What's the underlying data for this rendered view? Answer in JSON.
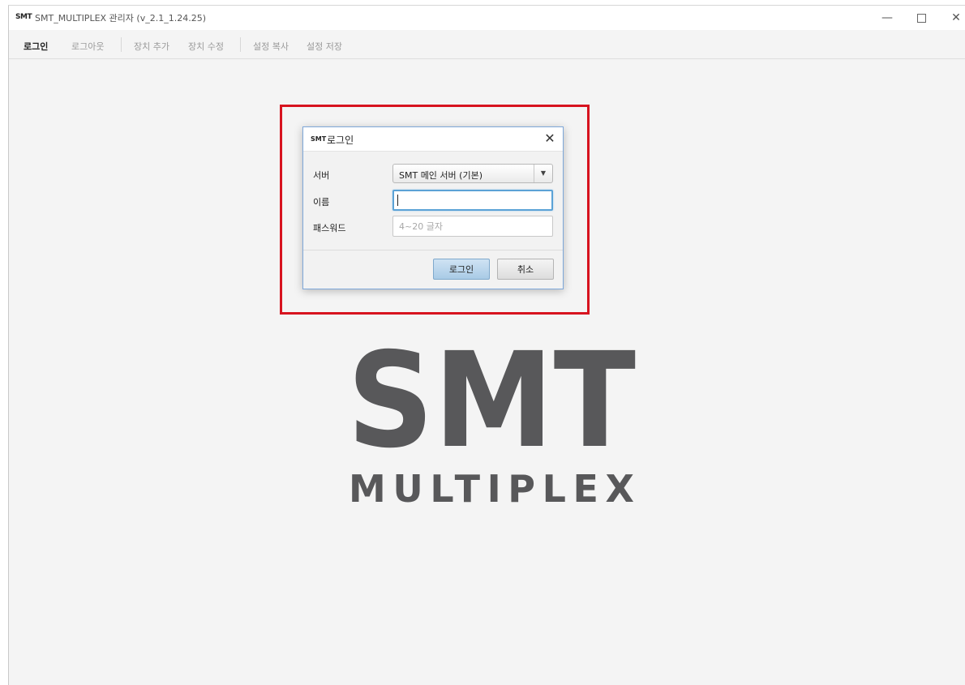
{
  "window": {
    "logo": "SMT",
    "title": "SMT_MULTIPLEX 관리자 (v_2.1_1.24.25)",
    "minimize": "—",
    "close": "✕"
  },
  "menu": {
    "items": [
      {
        "label": "로그인",
        "active": true
      },
      {
        "label": "로그아웃",
        "active": false
      },
      {
        "label": "장치 추가",
        "active": false
      },
      {
        "label": "장치 수정",
        "active": false
      },
      {
        "label": "설정 복사",
        "active": false
      },
      {
        "label": "설정 저장",
        "active": false
      }
    ]
  },
  "dialog": {
    "logo": "SMT",
    "title": "로그인",
    "close": "✕",
    "server_label": "서버",
    "server_value": "SMT 메인 서버 (기본)",
    "server_arrow": "▼",
    "name_label": "이름",
    "name_value": "",
    "password_label": "패스워드",
    "password_placeholder": "4~20 글자",
    "login_button": "로그인",
    "cancel_button": "취소"
  },
  "brand": {
    "main": "SMT",
    "sub": "MULTIPLEX",
    "color": "#58585a"
  },
  "colors": {
    "highlight": "#d7131f",
    "focus": "#5ba2d6",
    "login_button": "#a9cbe6"
  }
}
